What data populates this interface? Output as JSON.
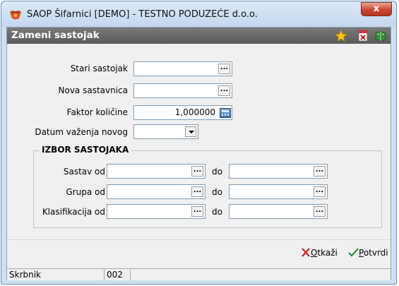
{
  "window": {
    "title": "SAOP Šifarnici [DEMO] - TESTNO PODUZEĆE d.o.o.",
    "close_label": "x"
  },
  "form": {
    "title": "Zameni sastojak"
  },
  "header_icons": [
    "star-icon",
    "delete-document-icon",
    "book-icon"
  ],
  "fields": {
    "stari": {
      "label": "Stari sastojak",
      "value": ""
    },
    "nova": {
      "label": "Nova sastavnica",
      "value": ""
    },
    "faktor": {
      "label": "Faktor količine",
      "value": "1,000000"
    },
    "datum": {
      "label": "Datum važenja novog",
      "value": ""
    }
  },
  "group": {
    "title": "IZBOR SASTOJAKA",
    "to_label": "do",
    "rows": [
      {
        "label": "Sastav od"
      },
      {
        "label": "Grupa od"
      },
      {
        "label": "Klasifikacija od"
      }
    ]
  },
  "buttons": {
    "cancel": "Otkaži",
    "cancel_accel": "O",
    "confirm": "Potvrdi",
    "confirm_accel": "P"
  },
  "status": {
    "label": "Skrbnik",
    "value": "002"
  },
  "colors": {
    "header": "#666666",
    "cancel": "#cc2222",
    "confirm": "#2f8f2f"
  }
}
